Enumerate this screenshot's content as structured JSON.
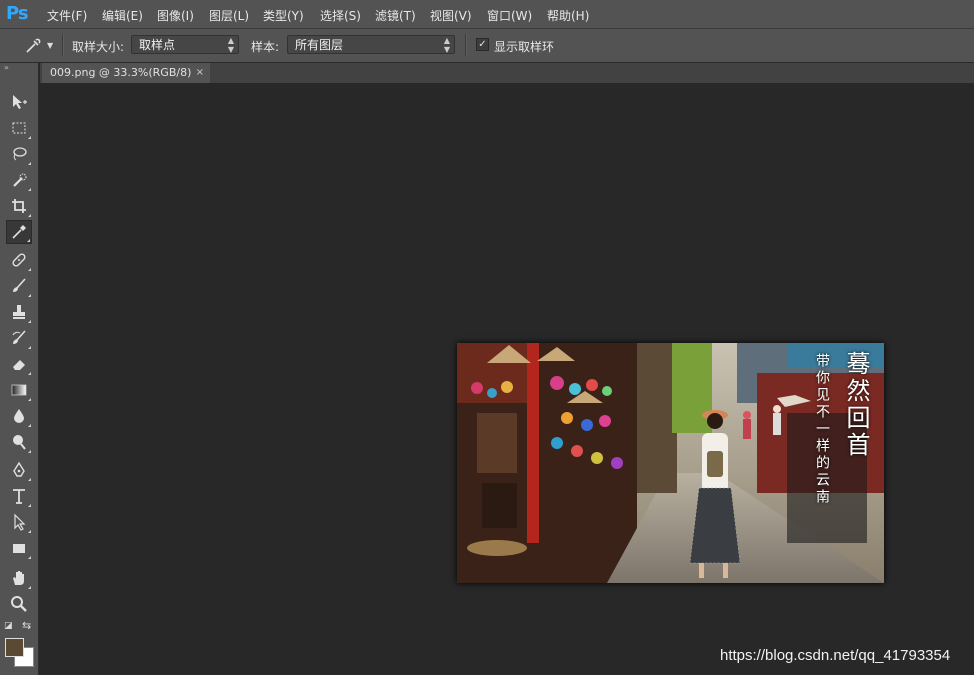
{
  "app": {
    "logo": "Ps"
  },
  "menu": [
    {
      "label": "文件(F)"
    },
    {
      "label": "编辑(E)"
    },
    {
      "label": "图像(I)"
    },
    {
      "label": "图层(L)"
    },
    {
      "label": "类型(Y)"
    },
    {
      "label": "选择(S)"
    },
    {
      "label": "滤镜(T)"
    },
    {
      "label": "视图(V)"
    },
    {
      "label": "窗口(W)"
    },
    {
      "label": "帮助(H)"
    }
  ],
  "options": {
    "sample_size_label": "取样大小:",
    "sample_size_value": "取样点",
    "sample_label": "样本:",
    "sample_value": "所有图层",
    "show_ring_label": "显示取样环",
    "show_ring_checked": "✓"
  },
  "document": {
    "tab_title": "009.png @ 33.3%(RGB/8)",
    "close": "×"
  },
  "photo": {
    "title": "蓦然回首",
    "subtitle": "带你见不一样的云南"
  },
  "colors": {
    "foreground": "#5a4a33",
    "background": "#ffffff"
  },
  "watermark": "https://blog.csdn.net/qq_41793354"
}
